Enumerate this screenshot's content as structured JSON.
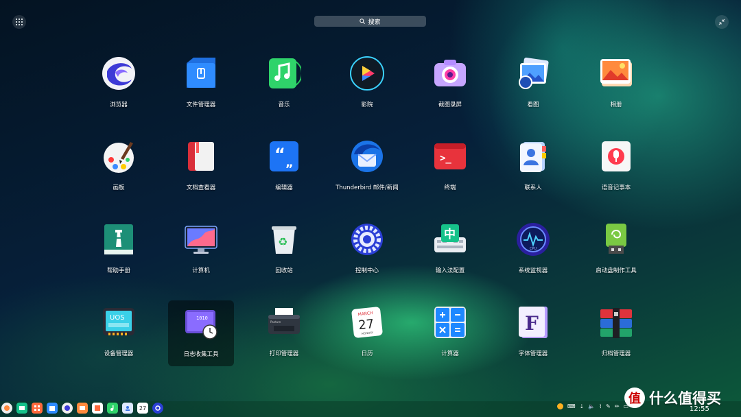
{
  "search": {
    "label": "搜索"
  },
  "apps": [
    {
      "label": "浏览器",
      "icon": "browser-icon"
    },
    {
      "label": "文件管理器",
      "icon": "file-manager-icon"
    },
    {
      "label": "音乐",
      "icon": "music-icon"
    },
    {
      "label": "影院",
      "icon": "movie-icon"
    },
    {
      "label": "截图录屏",
      "icon": "screenshot-icon"
    },
    {
      "label": "看图",
      "icon": "image-viewer-icon"
    },
    {
      "label": "相册",
      "icon": "album-icon"
    },
    {
      "label": "画板",
      "icon": "draw-icon"
    },
    {
      "label": "文档查看器",
      "icon": "document-viewer-icon"
    },
    {
      "label": "编辑器",
      "icon": "text-editor-icon"
    },
    {
      "label": "Thunderbird 邮件/新闻",
      "icon": "thunderbird-icon"
    },
    {
      "label": "终端",
      "icon": "terminal-icon"
    },
    {
      "label": "联系人",
      "icon": "contacts-icon"
    },
    {
      "label": "语音记事本",
      "icon": "voice-notes-icon"
    },
    {
      "label": "帮助手册",
      "icon": "manual-icon"
    },
    {
      "label": "计算机",
      "icon": "computer-icon"
    },
    {
      "label": "回收站",
      "icon": "trash-icon"
    },
    {
      "label": "控制中心",
      "icon": "control-center-icon"
    },
    {
      "label": "输入法配置",
      "icon": "input-method-icon"
    },
    {
      "label": "系统监视器",
      "icon": "system-monitor-icon"
    },
    {
      "label": "启动盘制作工具",
      "icon": "boot-maker-icon"
    },
    {
      "label": "设备管理器",
      "icon": "device-manager-icon"
    },
    {
      "label": "日志收集工具",
      "icon": "log-viewer-icon"
    },
    {
      "label": "打印管理器",
      "icon": "print-manager-icon"
    },
    {
      "label": "日历",
      "icon": "calendar-icon"
    },
    {
      "label": "计算器",
      "icon": "calculator-icon"
    },
    {
      "label": "字体管理器",
      "icon": "font-manager-icon"
    },
    {
      "label": "归档管理器",
      "icon": "archive-manager-icon"
    }
  ],
  "icon_text": {
    "terminal": ">_",
    "font": "F",
    "input_method": "中",
    "uos": "UOS",
    "binary": "1010",
    "calendar_month": "MARCH",
    "calendar_day": "27",
    "calendar_weekday": "MONDAY",
    "printer_brand": "Pantum",
    "cpu": "CPU"
  },
  "dock": {
    "calendar_day": "27"
  },
  "tray": {
    "clock": "12:55"
  },
  "watermark": {
    "logo": "值",
    "text": "什么值得买"
  },
  "colors": {
    "accent": "#2f8cff",
    "selected_bg": "rgba(0,0,0,0.45)"
  }
}
